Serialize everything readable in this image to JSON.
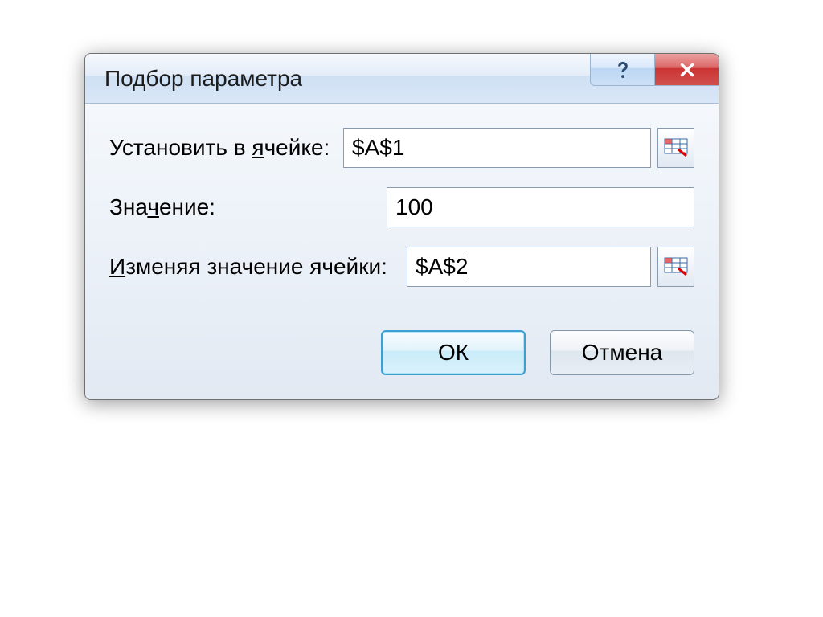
{
  "dialog": {
    "title": "Подбор параметра",
    "rows": {
      "set_cell": {
        "label_pre": "Установить в ",
        "label_u": "я",
        "label_post": "чейке:",
        "value": "$A$1"
      },
      "to_value": {
        "label_pre": "Зна",
        "label_u": "ч",
        "label_post": "ение:",
        "value": "100"
      },
      "changing": {
        "label_u": "И",
        "label_post": "зменяя значение ячейки:",
        "value": "$A$2"
      }
    },
    "buttons": {
      "ok": "ОК",
      "cancel": "Отмена"
    }
  }
}
